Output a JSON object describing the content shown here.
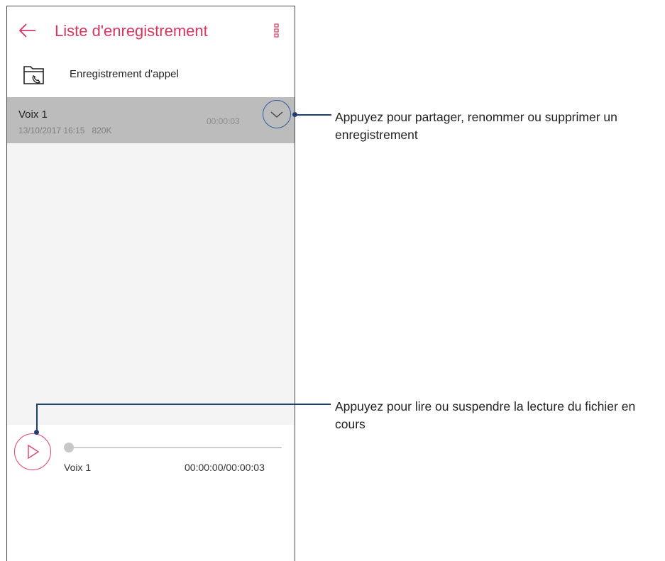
{
  "app_bar": {
    "title": "Liste d'enregistrement",
    "back_icon": "back-arrow-icon",
    "menu_icon": "more-options-icon",
    "accent_color": "#d9365f"
  },
  "folder": {
    "label": "Enregistrement d'appel",
    "icon": "call-recording-folder-icon"
  },
  "recordings": [
    {
      "name": "Voix 1",
      "date": "13/10/2017 16:15",
      "size": "820K",
      "duration": "00:00:03"
    }
  ],
  "player": {
    "track_name": "Voix 1",
    "time": "00:00:00/00:00:03",
    "progress": 0,
    "play_icon": "play-icon"
  },
  "annotations": {
    "expand": "Appuyez pour partager, renommer ou supprimer un enregistrement",
    "play": "Appuyez pour lire ou suspendre la lecture du fichier en cours"
  }
}
